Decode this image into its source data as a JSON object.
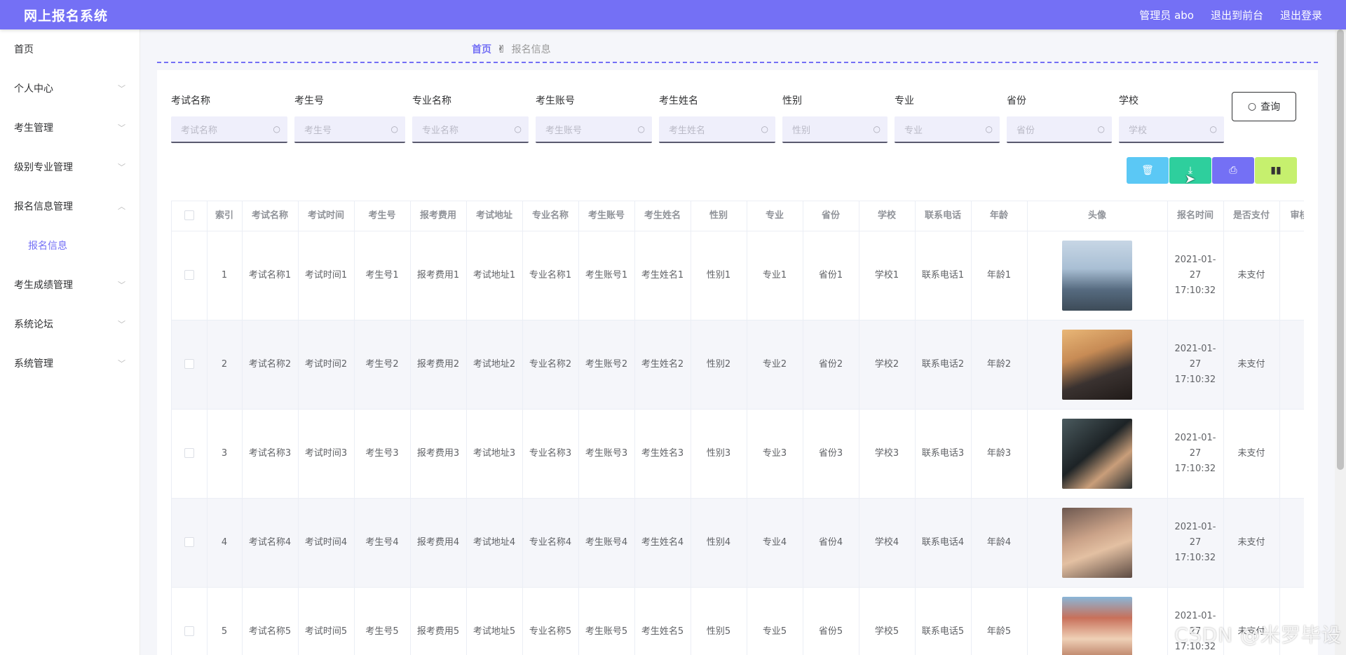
{
  "header": {
    "title": "网上报名系统",
    "admin": "管理员 abo",
    "back_front": "退出到前台",
    "logout": "退出登录"
  },
  "sidebar": {
    "items": [
      {
        "label": "首页",
        "chevron": false
      },
      {
        "label": "个人中心",
        "chevron": true
      },
      {
        "label": "考生管理",
        "chevron": true
      },
      {
        "label": "级别专业管理",
        "chevron": true
      },
      {
        "label": "报名信息管理",
        "chevron": true,
        "open": true
      },
      {
        "label": "报名信息",
        "sub": true
      },
      {
        "label": "考生成绩管理",
        "chevron": true
      },
      {
        "label": "系统论坛",
        "chevron": true
      },
      {
        "label": "系统管理",
        "chevron": true
      }
    ]
  },
  "breadcrumb": {
    "home": "首页",
    "current": "报名信息"
  },
  "search": {
    "fields": [
      {
        "label": "考试名称",
        "placeholder": "考试名称"
      },
      {
        "label": "考生号",
        "placeholder": "考生号"
      },
      {
        "label": "专业名称",
        "placeholder": "专业名称"
      },
      {
        "label": "考生账号",
        "placeholder": "考生账号"
      },
      {
        "label": "考生姓名",
        "placeholder": "考生姓名"
      },
      {
        "label": "性别",
        "placeholder": "性别"
      },
      {
        "label": "专业",
        "placeholder": "专业"
      },
      {
        "label": "省份",
        "placeholder": "省份"
      },
      {
        "label": "学校",
        "placeholder": "学校"
      }
    ],
    "query_label": "查询"
  },
  "actions": {
    "delete_icon": "trash-icon",
    "export_icon": "download-icon",
    "print_icon": "printer-icon",
    "stats_icon": "bar-chart-icon",
    "colors": [
      "#5bc8f5",
      "#2ecf9d",
      "#7470f5",
      "#c6f06e"
    ]
  },
  "table": {
    "columns": [
      "索引",
      "考试名称",
      "考试时间",
      "考生号",
      "报考费用",
      "考试地址",
      "专业名称",
      "考生账号",
      "考生姓名",
      "性别",
      "专业",
      "省份",
      "学校",
      "联系电话",
      "年龄",
      "头像",
      "报名时间",
      "是否支付",
      "审核"
    ],
    "rows": [
      [
        "1",
        "考试名称1",
        "考试时间1",
        "考生号1",
        "报考费用1",
        "考试地址1",
        "专业名称1",
        "考生账号1",
        "考生姓名1",
        "性别1",
        "专业1",
        "省份1",
        "学校1",
        "联系电话1",
        "年龄1",
        "",
        "2021-01-27 17:10:32",
        "未支付",
        ""
      ],
      [
        "2",
        "考试名称2",
        "考试时间2",
        "考生号2",
        "报考费用2",
        "考试地址2",
        "专业名称2",
        "考生账号2",
        "考生姓名2",
        "性别2",
        "专业2",
        "省份2",
        "学校2",
        "联系电话2",
        "年龄2",
        "",
        "2021-01-27 17:10:32",
        "未支付",
        ""
      ],
      [
        "3",
        "考试名称3",
        "考试时间3",
        "考生号3",
        "报考费用3",
        "考试地址3",
        "专业名称3",
        "考生账号3",
        "考生姓名3",
        "性别3",
        "专业3",
        "省份3",
        "学校3",
        "联系电话3",
        "年龄3",
        "",
        "2021-01-27 17:10:32",
        "未支付",
        ""
      ],
      [
        "4",
        "考试名称4",
        "考试时间4",
        "考生号4",
        "报考费用4",
        "考试地址4",
        "专业名称4",
        "考生账号4",
        "考生姓名4",
        "性别4",
        "专业4",
        "省份4",
        "学校4",
        "联系电话4",
        "年龄4",
        "",
        "2021-01-27 17:10:32",
        "未支付",
        ""
      ],
      [
        "5",
        "考试名称5",
        "考试时间5",
        "考生号5",
        "报考费用5",
        "考试地址5",
        "专业名称5",
        "考生账号5",
        "考生姓名5",
        "性别5",
        "专业5",
        "省份5",
        "学校5",
        "联系电话5",
        "年龄5",
        "",
        "2021-01-27 17:10:32",
        "未支付",
        ""
      ]
    ]
  },
  "watermark": "CSDN @米罗毕设",
  "theme": {
    "accent": "#7470f5"
  }
}
